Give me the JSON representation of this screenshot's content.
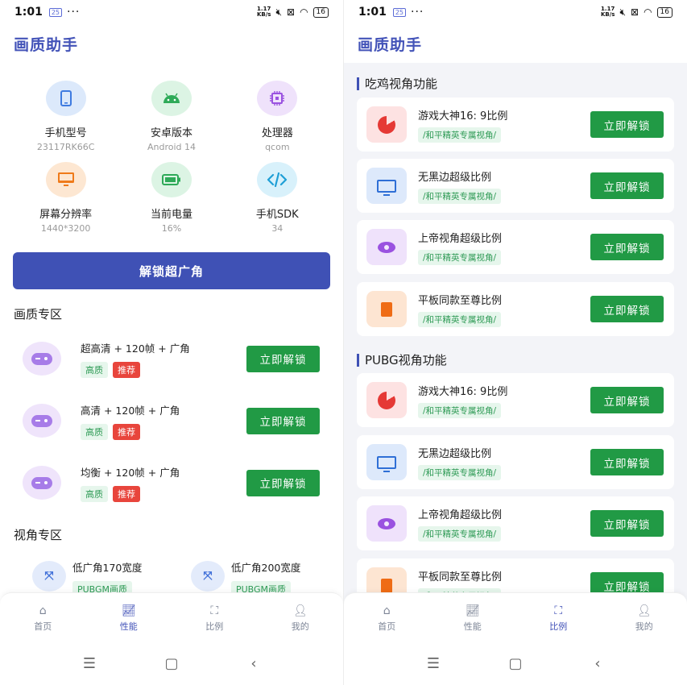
{
  "status_bar": {
    "time": "1:01",
    "notification": "25",
    "more": "···",
    "speed_value": "1.17",
    "speed_unit": "KB/s",
    "battery": "16"
  },
  "app": {
    "title": "画质助手"
  },
  "left": {
    "info": [
      {
        "label": "手机型号",
        "value": "23117RK66C",
        "icon": "phone-icon",
        "color": "#3f7be0",
        "bg": "#dce9fb"
      },
      {
        "label": "安卓版本",
        "value": "Android 14",
        "icon": "android-icon",
        "color": "#2eaa58",
        "bg": "#dcf4e4"
      },
      {
        "label": "处理器",
        "value": "qcom",
        "icon": "chip-icon",
        "color": "#9a52e0",
        "bg": "#efe2fb"
      },
      {
        "label": "屏幕分辨率",
        "value": "1440*3200",
        "icon": "monitor-icon",
        "color": "#ef7a1a",
        "bg": "#fde7d2"
      },
      {
        "label": "当前电量",
        "value": "16%",
        "icon": "battery-icon",
        "color": "#2eaa58",
        "bg": "#dcf4e4"
      },
      {
        "label": "手机SDK",
        "value": "34",
        "icon": "code-icon",
        "color": "#1f9fd6",
        "bg": "#d8f1fb"
      }
    ],
    "unlock_wide_label": "解锁超广角",
    "quality_section": "画质专区",
    "quality_rows": [
      {
        "name": "超高清 + 120帧 + 广角",
        "tag1": "高质",
        "tag2": "推荐",
        "button": "立即解锁"
      },
      {
        "name": "高清 + 120帧 + 广角",
        "tag1": "高质",
        "tag2": "推荐",
        "button": "立即解锁"
      },
      {
        "name": "均衡 + 120帧 + 广角",
        "tag1": "高质",
        "tag2": "推荐",
        "button": "立即解锁"
      }
    ],
    "fov_section": "视角专区",
    "fov_items": [
      {
        "name": "低广角170宽度",
        "tag": "PUBGM画质"
      },
      {
        "name": "低广角200宽度",
        "tag": "PUBGM画质"
      }
    ]
  },
  "right": {
    "section1": "吃鸡视角功能",
    "section2": "PUBG视角功能",
    "cards1": [
      {
        "name": "游戏大神16: 9比例",
        "tag": "/和平精英专属视角/",
        "button": "立即解锁",
        "icon": "pacman-icon",
        "bg": "#fde2e2"
      },
      {
        "name": "无黑边超级比例",
        "tag": "/和平精英专属视角/",
        "button": "立即解锁",
        "icon": "monitor-icon",
        "bg": "#dde9fb"
      },
      {
        "name": "上帝视角超级比例",
        "tag": "/和平精英专属视角/",
        "button": "立即解锁",
        "icon": "eye-icon",
        "bg": "#efe2fb"
      },
      {
        "name": "平板同款至尊比例",
        "tag": "/和平精英专属视角/",
        "button": "立即解锁",
        "icon": "tablet-icon",
        "bg": "#fde5d2"
      }
    ],
    "cards2": [
      {
        "name": "游戏大神16: 9比例",
        "tag": "/和平精英专属视角/",
        "button": "立即解锁",
        "icon": "pacman-icon",
        "bg": "#fde2e2"
      },
      {
        "name": "无黑边超级比例",
        "tag": "/和平精英专属视角/",
        "button": "立即解锁",
        "icon": "monitor-icon",
        "bg": "#dde9fb"
      },
      {
        "name": "上帝视角超级比例",
        "tag": "/和平精英专属视角/",
        "button": "立即解锁",
        "icon": "eye-icon",
        "bg": "#efe2fb"
      },
      {
        "name": "平板同款至尊比例",
        "tag": "/和平精英专属视角/",
        "button": "立即解锁",
        "icon": "tablet-icon",
        "bg": "#fde5d2"
      }
    ]
  },
  "nav": [
    {
      "label": "首页",
      "icon": "home-icon"
    },
    {
      "label": "性能",
      "icon": "chart-icon"
    },
    {
      "label": "比例",
      "icon": "ratio-icon"
    },
    {
      "label": "我的",
      "icon": "user-icon"
    }
  ],
  "colors": {
    "accent": "#3f51b5",
    "unlock_green": "#219a45",
    "tag_green_bg": "#e6f6ec",
    "tag_red": "#e8453c"
  }
}
